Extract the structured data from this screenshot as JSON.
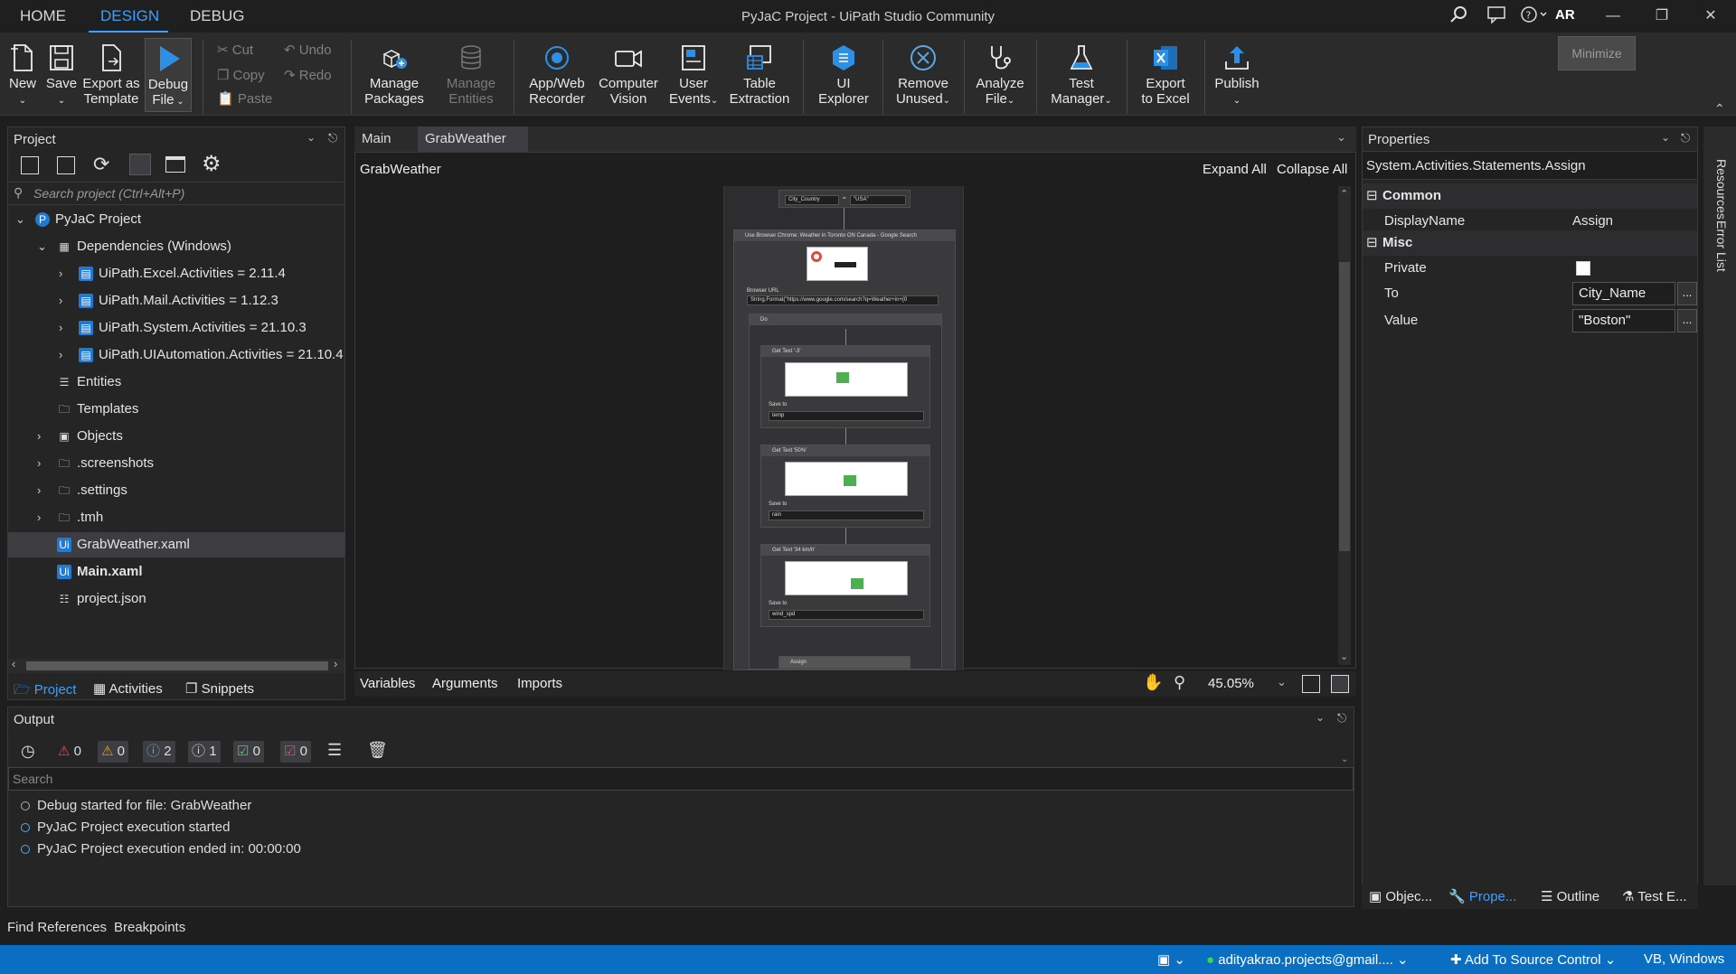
{
  "window": {
    "title": "PyJaC Project - UiPath Studio Community",
    "tabs": [
      "HOME",
      "DESIGN",
      "DEBUG"
    ],
    "avatar": "AR",
    "tooltip": "Minimize"
  },
  "ribbon": {
    "new": "New",
    "save": "Save",
    "export_template": [
      "Export as",
      "Template"
    ],
    "debug_file": [
      "Debug",
      "File"
    ],
    "cut": "Cut",
    "copy": "Copy",
    "paste": "Paste",
    "undo": "Undo",
    "redo": "Redo",
    "manage_packages": [
      "Manage",
      "Packages"
    ],
    "manage_entities": [
      "Manage",
      "Entities"
    ],
    "recorder": [
      "App/Web",
      "Recorder"
    ],
    "computer_vision": [
      "Computer",
      "Vision"
    ],
    "user_events": [
      "User",
      "Events"
    ],
    "table_extraction": [
      "Table",
      "Extraction"
    ],
    "ui_explorer": [
      "UI",
      "Explorer"
    ],
    "remove_unused": [
      "Remove",
      "Unused"
    ],
    "analyze_file": [
      "Analyze",
      "File"
    ],
    "test_manager": [
      "Test",
      "Manager"
    ],
    "export_excel": [
      "Export",
      "to Excel"
    ],
    "publish": "Publish"
  },
  "project": {
    "title": "Project",
    "search_placeholder": "Search project (Ctrl+Alt+P)",
    "tree": [
      {
        "label": "PyJaC Project",
        "level": 0,
        "arrow": "v",
        "icon": "project-icon",
        "bold": false
      },
      {
        "label": "Dependencies (Windows)",
        "level": 1,
        "arrow": "v",
        "icon": "dependencies-icon",
        "bold": false
      },
      {
        "label": "UiPath.Excel.Activities = 2.11.4",
        "level": 2,
        "arrow": ">",
        "icon": "package-icon",
        "bold": false
      },
      {
        "label": "UiPath.Mail.Activities = 1.12.3",
        "level": 2,
        "arrow": ">",
        "icon": "package-icon",
        "bold": false
      },
      {
        "label": "UiPath.System.Activities = 21.10.3",
        "level": 2,
        "arrow": ">",
        "icon": "package-icon",
        "bold": false
      },
      {
        "label": "UiPath.UIAutomation.Activities = 21.10.4",
        "level": 2,
        "arrow": ">",
        "icon": "package-icon",
        "bold": false
      },
      {
        "label": "Entities",
        "level": 1,
        "arrow": "",
        "icon": "entities-icon",
        "bold": false
      },
      {
        "label": "Templates",
        "level": 1,
        "arrow": "",
        "icon": "folder-icon",
        "bold": false
      },
      {
        "label": "Objects",
        "level": 1,
        "arrow": ">",
        "icon": "objects-icon",
        "bold": false
      },
      {
        "label": ".screenshots",
        "level": 1,
        "arrow": ">",
        "icon": "folder-icon",
        "bold": false
      },
      {
        "label": ".settings",
        "level": 1,
        "arrow": ">",
        "icon": "folder-icon",
        "bold": false
      },
      {
        "label": ".tmh",
        "level": 1,
        "arrow": ">",
        "icon": "folder-icon",
        "bold": false
      },
      {
        "label": "GrabWeather.xaml",
        "level": 1,
        "arrow": "",
        "icon": "xaml-icon",
        "bold": false
      },
      {
        "label": "Main.xaml",
        "level": 1,
        "arrow": "",
        "icon": "xaml-icon",
        "bold": true
      },
      {
        "label": "project.json",
        "level": 1,
        "arrow": "",
        "icon": "json-icon",
        "bold": false
      }
    ],
    "selected_index": 12,
    "bottom_tabs": [
      "Project",
      "Activities",
      "Snippets"
    ]
  },
  "designer": {
    "tabs": [
      "Main",
      "GrabWeather"
    ],
    "breadcrumb": "GrabWeather",
    "expand_all": "Expand All",
    "collapse_all": "Collapse All",
    "bottom_tabs": [
      "Variables",
      "Arguments",
      "Imports"
    ],
    "zoom": "45.05%",
    "workflow": {
      "assign_top": {
        "to": "City_Country",
        "value": "\"USA\""
      },
      "browser_scope": "Use Browser Chrome: Weather in Toronto ON Canada - Google Search",
      "browser_url_label": "Browser URL",
      "browser_url": "String.Format(\"https://www.google.com/search?q=Weather+in+{0",
      "do_label": "Do",
      "get_texts": [
        {
          "title": "Get Text '-3'",
          "save_label": "Save to",
          "save_to": "temp"
        },
        {
          "title": "Get Text '50%'",
          "save_label": "Save to",
          "save_to": "rain"
        },
        {
          "title": "Get Text '34 km/h'",
          "save_label": "Save to",
          "save_to": "wind_spd"
        }
      ],
      "assign_bottom": "Assign"
    }
  },
  "properties": {
    "title": "Properties",
    "type": "System.Activities.Statements.Assign",
    "sections": {
      "common": "Common",
      "misc": "Misc"
    },
    "display_name_label": "DisplayName",
    "display_name": "Assign",
    "private_label": "Private",
    "to_label": "To",
    "to_value": "City_Name",
    "value_label": "Value",
    "value_value": "\"Boston\"",
    "ellipsis": "...",
    "bottom_tabs": [
      "Objec...",
      "Prope...",
      "Outline",
      "Test E..."
    ],
    "side_tabs": [
      "Resources",
      "Error List"
    ]
  },
  "output": {
    "title": "Output",
    "counts": {
      "errors": "0",
      "warnings": "0",
      "info": "2",
      "trace": "1",
      "success": "0",
      "failed": "0"
    },
    "search_placeholder": "Search",
    "lines": [
      "Debug started for file: GrabWeather",
      "PyJaC Project execution started",
      "PyJaC Project execution ended in: 00:00:00"
    ]
  },
  "bottom_links": [
    "Find References",
    "Breakpoints"
  ],
  "statusbar": {
    "account": "adityakrao.projects@gmail....",
    "source_control": "Add To Source Control",
    "lang": "VB, Windows"
  },
  "colors": {
    "accent": "#3aa0ff",
    "status_bar": "#0a6fc2",
    "background": "#1e1e1e"
  }
}
